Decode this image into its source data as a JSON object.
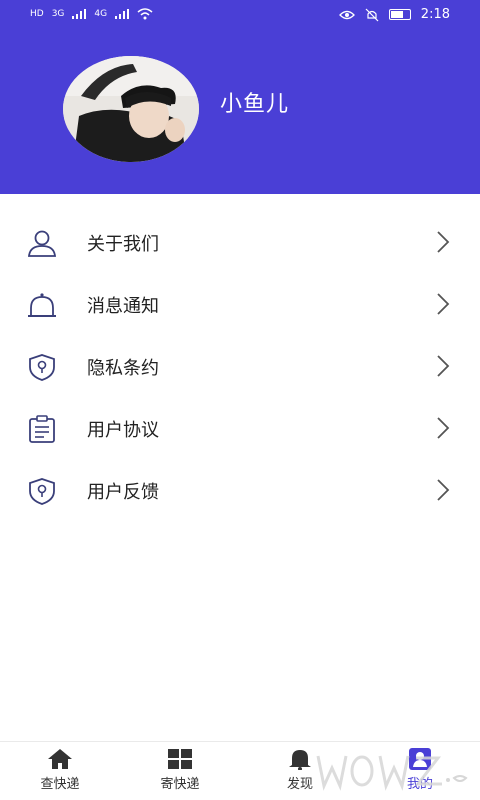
{
  "status_bar": {
    "network_left": "HD",
    "sim_tags": [
      "3G",
      "4G"
    ],
    "time": "2:18"
  },
  "profile": {
    "username": "小鱼儿"
  },
  "menu": {
    "items": [
      {
        "label": "关于我们",
        "icon": "user-icon"
      },
      {
        "label": "消息通知",
        "icon": "bell-icon"
      },
      {
        "label": "隐私条约",
        "icon": "shield-icon"
      },
      {
        "label": "用户协议",
        "icon": "clipboard-icon"
      },
      {
        "label": "用户反馈",
        "icon": "shield-icon"
      }
    ]
  },
  "tabbar": {
    "tabs": [
      {
        "label": "查快递",
        "icon": "home-icon"
      },
      {
        "label": "寄快递",
        "icon": "grid-icon"
      },
      {
        "label": "发现",
        "icon": "bell-icon"
      },
      {
        "label": "我的",
        "icon": "profile-icon",
        "active": true
      }
    ]
  },
  "colors": {
    "accent": "#4a3fd6",
    "text": "#222222",
    "icon_stroke": "#3a3f7a"
  }
}
